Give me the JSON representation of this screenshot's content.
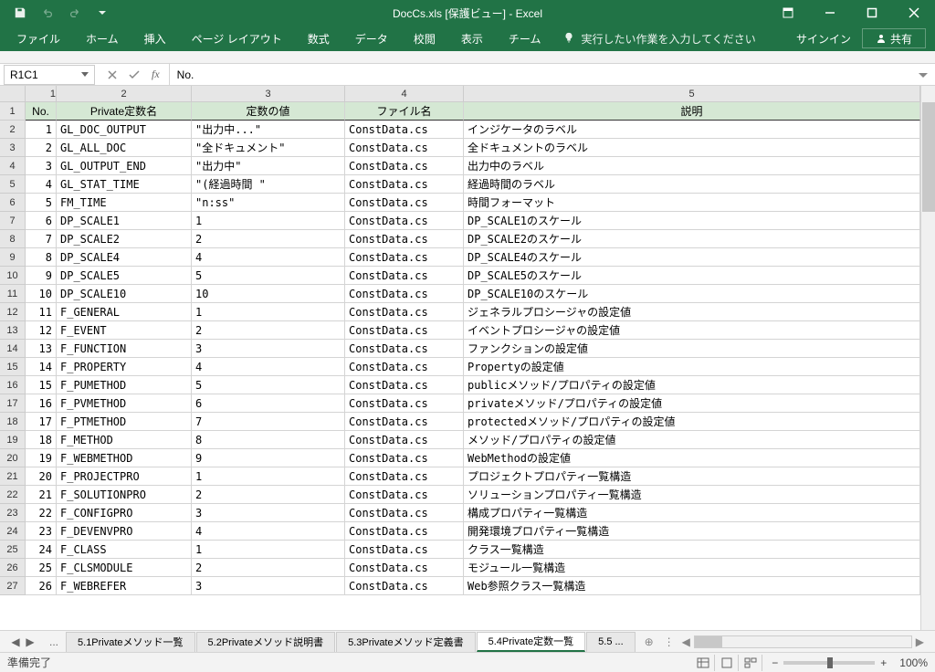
{
  "title": "DocCs.xls  [保護ビュー] - Excel",
  "qat": {
    "save": "save",
    "undo": "undo",
    "redo": "redo"
  },
  "tabs": [
    "ファイル",
    "ホーム",
    "挿入",
    "ページ レイアウト",
    "数式",
    "データ",
    "校閲",
    "表示",
    "チーム"
  ],
  "tellme": "実行したい作業を入力してください",
  "signin": "サインイン",
  "share": "共有",
  "nameBox": "R1C1",
  "formula": "No.",
  "colHeaders": [
    "1",
    "2",
    "3",
    "4",
    "5"
  ],
  "tableHeaders": {
    "no": "No.",
    "name": "Private定数名",
    "value": "定数の値",
    "file": "ファイル名",
    "desc": "説明"
  },
  "rows": [
    {
      "n": "1",
      "name": "GL_DOC_OUTPUT",
      "val": "\"出力中...\"",
      "file": "ConstData.cs",
      "desc": "インジケータのラベル"
    },
    {
      "n": "2",
      "name": "GL_ALL_DOC",
      "val": "\"全ドキュメント\"",
      "file": "ConstData.cs",
      "desc": "全ドキュメントのラベル"
    },
    {
      "n": "3",
      "name": "GL_OUTPUT_END",
      "val": "\"出力中\"",
      "file": "ConstData.cs",
      "desc": "出力中のラベル"
    },
    {
      "n": "4",
      "name": "GL_STAT_TIME",
      "val": "\"(経過時間 \"",
      "file": "ConstData.cs",
      "desc": "経過時間のラベル"
    },
    {
      "n": "5",
      "name": "FM_TIME",
      "val": "\"n:ss\"",
      "file": "ConstData.cs",
      "desc": "時間フォーマット"
    },
    {
      "n": "6",
      "name": "DP_SCALE1",
      "val": "1",
      "file": "ConstData.cs",
      "desc": "DP_SCALE1のスケール"
    },
    {
      "n": "7",
      "name": "DP_SCALE2",
      "val": "2",
      "file": "ConstData.cs",
      "desc": "DP_SCALE2のスケール"
    },
    {
      "n": "8",
      "name": "DP_SCALE4",
      "val": "4",
      "file": "ConstData.cs",
      "desc": "DP_SCALE4のスケール"
    },
    {
      "n": "9",
      "name": "DP_SCALE5",
      "val": "5",
      "file": "ConstData.cs",
      "desc": "DP_SCALE5のスケール"
    },
    {
      "n": "10",
      "name": "DP_SCALE10",
      "val": "10",
      "file": "ConstData.cs",
      "desc": "DP_SCALE10のスケール"
    },
    {
      "n": "11",
      "name": "F_GENERAL",
      "val": "1",
      "file": "ConstData.cs",
      "desc": "ジェネラルプロシージャの設定値"
    },
    {
      "n": "12",
      "name": "F_EVENT",
      "val": "2",
      "file": "ConstData.cs",
      "desc": "イベントプロシージャの設定値"
    },
    {
      "n": "13",
      "name": "F_FUNCTION",
      "val": "3",
      "file": "ConstData.cs",
      "desc": "ファンクションの設定値"
    },
    {
      "n": "14",
      "name": "F_PROPERTY",
      "val": "4",
      "file": "ConstData.cs",
      "desc": "Propertyの設定値"
    },
    {
      "n": "15",
      "name": "F_PUMETHOD",
      "val": "5",
      "file": "ConstData.cs",
      "desc": "publicメソッド/プロパティの設定値"
    },
    {
      "n": "16",
      "name": "F_PVMETHOD",
      "val": "6",
      "file": "ConstData.cs",
      "desc": "privateメソッド/プロパティの設定値"
    },
    {
      "n": "17",
      "name": "F_PTMETHOD",
      "val": "7",
      "file": "ConstData.cs",
      "desc": "protectedメソッド/プロパティの設定値"
    },
    {
      "n": "18",
      "name": "F_METHOD",
      "val": "8",
      "file": "ConstData.cs",
      "desc": "メソッド/プロパティの設定値"
    },
    {
      "n": "19",
      "name": "F_WEBMETHOD",
      "val": "9",
      "file": "ConstData.cs",
      "desc": "WebMethodの設定値"
    },
    {
      "n": "20",
      "name": "F_PROJECTPRO",
      "val": "1",
      "file": "ConstData.cs",
      "desc": "プロジェクトプロパティ一覧構造"
    },
    {
      "n": "21",
      "name": "F_SOLUTIONPRO",
      "val": "2",
      "file": "ConstData.cs",
      "desc": "ソリューションプロパティ一覧構造"
    },
    {
      "n": "22",
      "name": "F_CONFIGPRO",
      "val": "3",
      "file": "ConstData.cs",
      "desc": "構成プロパティ一覧構造"
    },
    {
      "n": "23",
      "name": "F_DEVENVPRO",
      "val": "4",
      "file": "ConstData.cs",
      "desc": "開発環境プロパティ一覧構造"
    },
    {
      "n": "24",
      "name": "F_CLASS",
      "val": "1",
      "file": "ConstData.cs",
      "desc": "クラス一覧構造"
    },
    {
      "n": "25",
      "name": "F_CLSMODULE",
      "val": "2",
      "file": "ConstData.cs",
      "desc": "モジュール一覧構造"
    },
    {
      "n": "26",
      "name": "F_WEBREFER",
      "val": "3",
      "file": "ConstData.cs",
      "desc": "Web参照クラス一覧構造"
    }
  ],
  "sheetTabs": [
    "5.1Privateメソッド一覧",
    "5.2Privateメソッド説明書",
    "5.3Privateメソッド定義書",
    "5.4Private定数一覧",
    "5.5 ..."
  ],
  "activeSheet": 3,
  "status": "準備完了",
  "zoom": "100%"
}
